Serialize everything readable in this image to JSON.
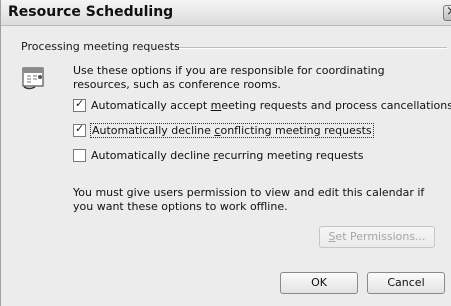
{
  "window": {
    "title": "Resource Scheduling",
    "close_glyph": "×"
  },
  "group": {
    "label": "Processing meeting requests",
    "icon": "calendar-icon",
    "description": "Use these options if you are responsible for coordinating resources, such as conference rooms."
  },
  "options": [
    {
      "before": "Automatically accept ",
      "key": "m",
      "after": "eeting requests and process cancellations",
      "checked": true,
      "check_glyph": "✓"
    },
    {
      "before": "Automatically decline ",
      "key": "c",
      "after": "onflicting meeting requests",
      "checked": true,
      "check_glyph": "✓"
    },
    {
      "before": "Automatically decline ",
      "key": "r",
      "after": "ecurring meeting requests",
      "checked": false,
      "check_glyph": ""
    }
  ],
  "note": "You must give users permission to view and edit this calendar if you want these options to work offline.",
  "buttons": {
    "permissions_key": "S",
    "permissions_rest": "et Permissions...",
    "ok": "OK",
    "cancel": "Cancel"
  }
}
